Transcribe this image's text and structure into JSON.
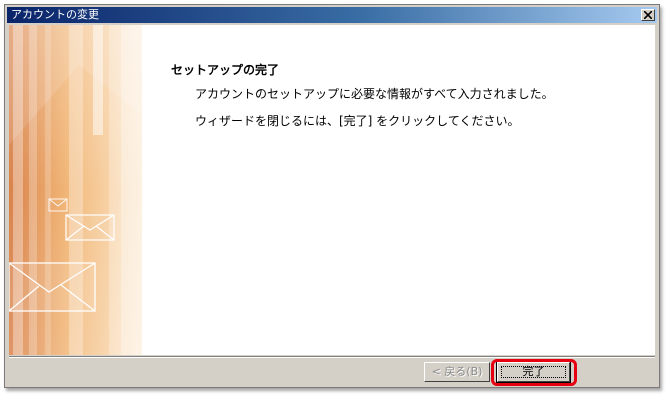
{
  "window": {
    "title": "アカウントの変更"
  },
  "main": {
    "heading": "セットアップの完了",
    "line1": "アカウントのセットアップに必要な情報がすべて入力されました。",
    "line2": "ウィザードを閉じるには、[完了] をクリックしてください。"
  },
  "buttons": {
    "back_label": "< 戻る(B)",
    "finish_label": "完了"
  },
  "colors": {
    "titlebar_start": "#0a246a",
    "titlebar_end": "#a6caf0",
    "dialog_face": "#d4d0c8",
    "highlight": "#e60012"
  },
  "icons": {
    "close": "close-icon",
    "envelopes": "envelope-icon"
  }
}
